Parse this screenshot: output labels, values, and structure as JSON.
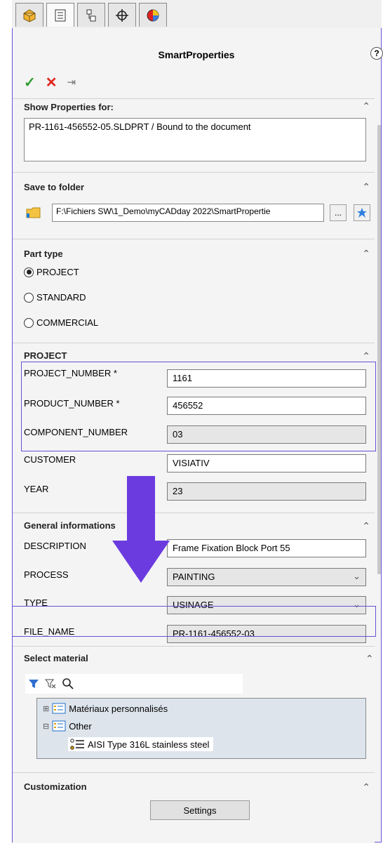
{
  "tabs": [
    {
      "icon": "feature-manager-icon"
    },
    {
      "icon": "property-manager-icon"
    },
    {
      "icon": "configuration-manager-icon"
    },
    {
      "icon": "dimxpert-icon"
    },
    {
      "icon": "display-manager-icon"
    }
  ],
  "panel": {
    "title": "SmartProperties",
    "help": "?"
  },
  "actions": {
    "ok": "✓",
    "cancel": "✕",
    "pin": "⇥"
  },
  "show_properties": {
    "title": "Show Properties for:",
    "value": "PR-1161-456552-05.SLDPRT / Bound to the document"
  },
  "save_folder": {
    "title": "Save to folder",
    "path": "F:\\Fichiers SW\\1_Demo\\myCADday 2022\\SmartPropertie",
    "browse_label": "..."
  },
  "part_type": {
    "title": "Part type",
    "options": [
      "PROJECT",
      "STANDARD",
      "COMMERCIAL"
    ],
    "selected": "PROJECT"
  },
  "project": {
    "title": "PROJECT",
    "fields": [
      {
        "label": "PROJECT_NUMBER *",
        "value": "1161",
        "readonly": false
      },
      {
        "label": "PRODUCT_NUMBER *",
        "value": "456552",
        "readonly": false
      },
      {
        "label": "COMPONENT_NUMBER",
        "value": "03",
        "readonly": true
      },
      {
        "label": "CUSTOMER",
        "value": "VISIATIV",
        "readonly": false
      },
      {
        "label": "YEAR",
        "value": "23",
        "readonly": true
      }
    ]
  },
  "general": {
    "title": "General informations",
    "fields": [
      {
        "label": "DESCRIPTION",
        "value": "Frame Fixation Block Port 55",
        "kind": "text"
      },
      {
        "label": "PROCESS",
        "value": "PAINTING",
        "kind": "select"
      },
      {
        "label": "TYPE",
        "value": "USINAGE",
        "kind": "select"
      },
      {
        "label": "FILE_NAME",
        "value": "PR-1161-456552-03",
        "kind": "readonly"
      }
    ]
  },
  "material": {
    "title": "Select material",
    "tree": [
      {
        "expander": "⊞",
        "label": "Matériaux personnalisés"
      },
      {
        "expander": "⊟",
        "label": "Other"
      },
      {
        "expander": "",
        "label": "AISI Type 316L stainless steel"
      }
    ]
  },
  "customization": {
    "title": "Customization",
    "settings_label": "Settings"
  },
  "colors": {
    "accent": "#6a4fd8",
    "arrow": "#6b3be0",
    "ok": "#2e9c2e",
    "cancel": "#e0261e"
  }
}
